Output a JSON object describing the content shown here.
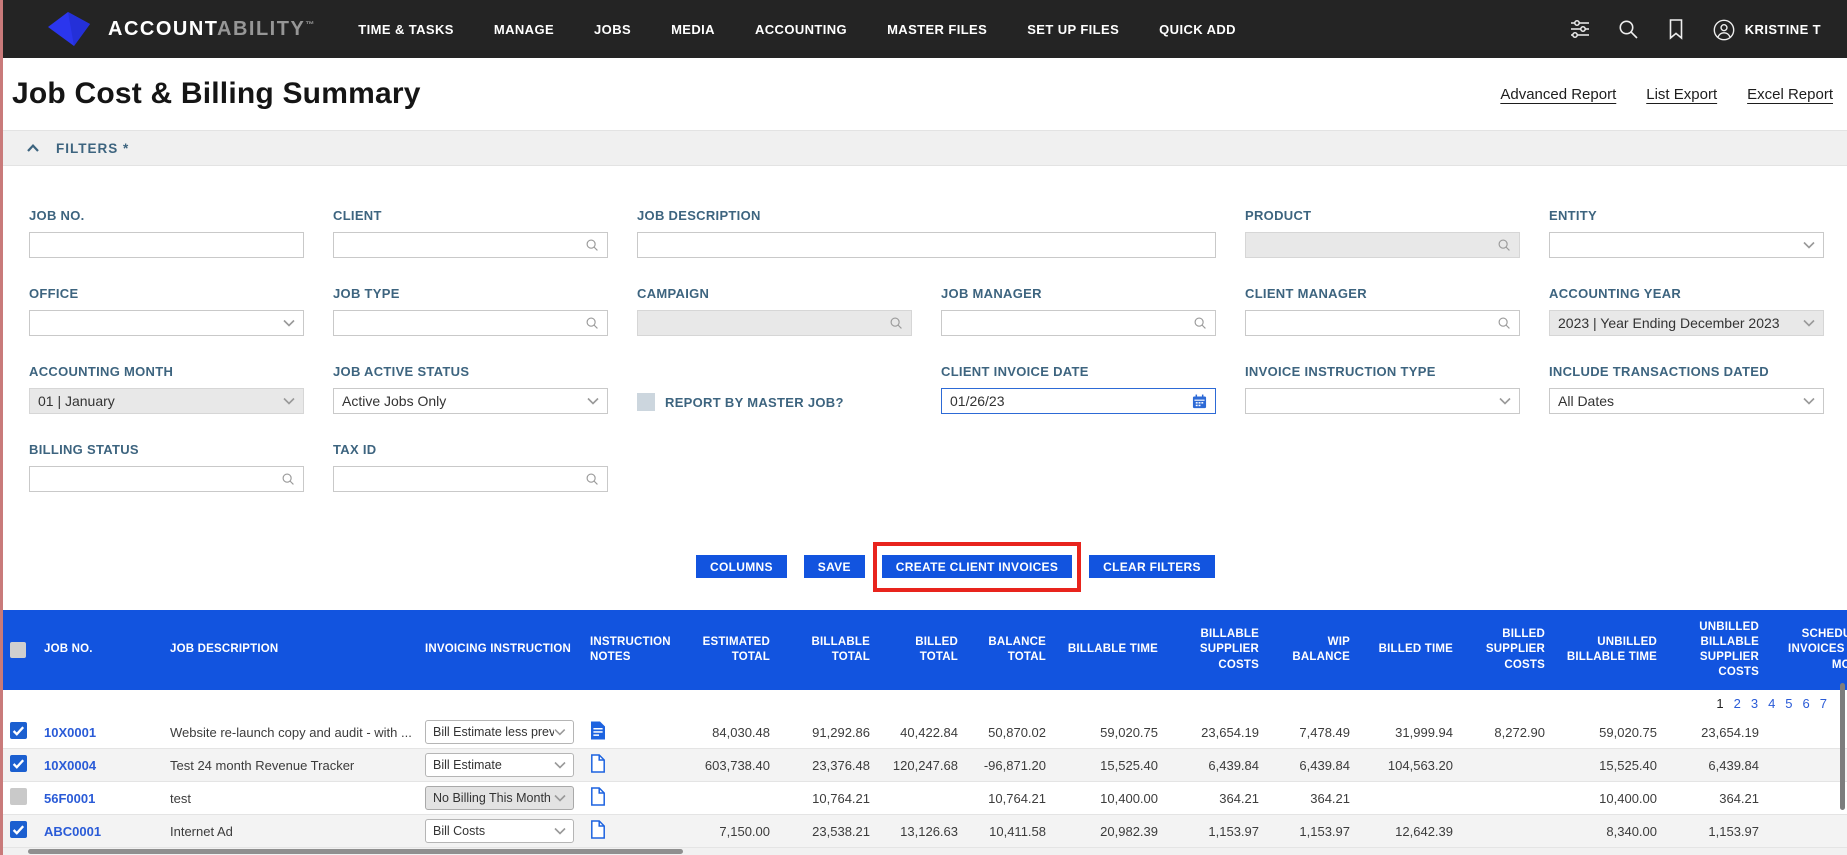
{
  "nav": {
    "brand": {
      "strong": "ACCOUNT",
      "light": "ABILITY",
      "tm": "™"
    },
    "items": [
      "TIME & TASKS",
      "MANAGE",
      "JOBS",
      "MEDIA",
      "ACCOUNTING",
      "MASTER FILES",
      "SET UP FILES",
      "QUICK ADD"
    ],
    "icons": [
      "filter-sliders",
      "search",
      "bookmark",
      "user-profile"
    ],
    "user": "KRISTINE T"
  },
  "header": {
    "title": "Job Cost & Billing Summary",
    "links": [
      "Advanced Report",
      "List Export",
      "Excel Report"
    ]
  },
  "filters": {
    "label": "FILTERS *",
    "fields": [
      {
        "label": "JOB NO.",
        "kind": "text",
        "value": ""
      },
      {
        "label": "CLIENT",
        "kind": "search",
        "value": ""
      },
      {
        "label": "JOB DESCRIPTION",
        "kind": "text",
        "value": "",
        "span": 2
      },
      {
        "label": "PRODUCT",
        "kind": "search",
        "value": "",
        "disabled": true
      },
      {
        "label": "ENTITY",
        "kind": "select",
        "value": ""
      },
      {
        "label": "OFFICE",
        "kind": "select",
        "value": ""
      },
      {
        "label": "JOB TYPE",
        "kind": "search",
        "value": ""
      },
      {
        "label": "CAMPAIGN",
        "kind": "search",
        "value": "",
        "disabled": true
      },
      {
        "label": "JOB MANAGER",
        "kind": "search",
        "value": ""
      },
      {
        "label": "CLIENT MANAGER",
        "kind": "search",
        "value": ""
      },
      {
        "label": "ACCOUNTING YEAR",
        "kind": "select",
        "value": "2023 | Year Ending December 2023",
        "disabled": true
      },
      {
        "label": "ACCOUNTING MONTH",
        "kind": "select",
        "value": "01 | January",
        "disabled": true
      },
      {
        "label": "JOB ACTIVE STATUS",
        "kind": "select",
        "value": "Active Jobs Only"
      },
      {
        "label": "REPORT BY MASTER JOB?",
        "kind": "checkbox",
        "checked": false
      },
      {
        "label": "CLIENT INVOICE DATE",
        "kind": "date",
        "value": "01/26/23"
      },
      {
        "label": "INVOICE INSTRUCTION TYPE",
        "kind": "select",
        "value": ""
      },
      {
        "label": "INCLUDE TRANSACTIONS DATED",
        "kind": "select",
        "value": "All Dates"
      },
      {
        "label": "BILLING STATUS",
        "kind": "search",
        "value": ""
      },
      {
        "label": "TAX ID",
        "kind": "search",
        "value": ""
      }
    ]
  },
  "actions": {
    "columns": "COLUMNS",
    "save": "SAVE",
    "create_client_invoices": "CREATE CLIENT INVOICES",
    "clear_filters": "CLEAR FILTERS"
  },
  "annotation": {
    "highlighted_button": "CREATE CLIENT INVOICES"
  },
  "table": {
    "columns": [
      "JOB NO.",
      "JOB DESCRIPTION",
      "INVOICING INSTRUCTION",
      "INSTRUCTION NOTES",
      "ESTIMATED TOTAL",
      "BILLABLE TOTAL",
      "BILLED TOTAL",
      "BALANCE TOTAL",
      "BILLABLE TIME",
      "BILLABLE SUPPLIER COSTS",
      "WIP BALANCE",
      "BILLED TIME",
      "BILLED SUPPLIER COSTS",
      "UNBILLED BILLABLE TIME",
      "UNBILLED BILLABLE SUPPLIER COSTS",
      "SCHEDULED INVOICES THIS MONTH"
    ],
    "pagination": {
      "current": "1",
      "pages": [
        "2",
        "3",
        "4",
        "5",
        "6",
        "7"
      ]
    },
    "rows": [
      {
        "checkbox": "checked",
        "job_no": "10X0001",
        "description": "Website re-launch copy and audit - with ...",
        "instruction": "Bill Estimate less prev.",
        "instruction_disabled": false,
        "notes_icon": "filled",
        "values": [
          "84,030.48",
          "91,292.86",
          "40,422.84",
          "50,870.02",
          "59,020.75",
          "23,654.19",
          "7,478.49",
          "31,999.94",
          "8,272.90",
          "59,020.75",
          "23,654.19",
          ""
        ]
      },
      {
        "checkbox": "checked",
        "job_no": "10X0004",
        "description": "Test 24 month Revenue Tracker",
        "instruction": "Bill Estimate",
        "instruction_disabled": false,
        "notes_icon": "outline",
        "values": [
          "603,738.40",
          "23,376.48",
          "120,247.68",
          "-96,871.20",
          "15,525.40",
          "6,439.84",
          "6,439.84",
          "104,563.20",
          "",
          "15,525.40",
          "6,439.84",
          ""
        ]
      },
      {
        "checkbox": "disabled",
        "job_no": "56F0001",
        "description": "test",
        "instruction": "No Billing This Month",
        "instruction_disabled": true,
        "notes_icon": "outline",
        "values": [
          "",
          "10,764.21",
          "",
          "10,764.21",
          "10,400.00",
          "364.21",
          "364.21",
          "",
          "",
          "10,400.00",
          "364.21",
          ""
        ]
      },
      {
        "checkbox": "checked",
        "job_no": "ABC0001",
        "description": "Internet Ad",
        "instruction": "Bill Costs",
        "instruction_disabled": false,
        "notes_icon": "outline",
        "values": [
          "7,150.00",
          "23,538.21",
          "13,126.63",
          "10,411.58",
          "20,982.39",
          "1,153.97",
          "1,153.97",
          "12,642.39",
          "",
          "8,340.00",
          "1,153.97",
          ""
        ]
      }
    ]
  },
  "colors": {
    "nav_bg": "#242424",
    "primary_blue": "#1254df",
    "highlight_red": "#e8241d",
    "label_blue": "#3d647f",
    "link_blue": "#2a5bd7",
    "logo_blue": "#2b36ee"
  }
}
